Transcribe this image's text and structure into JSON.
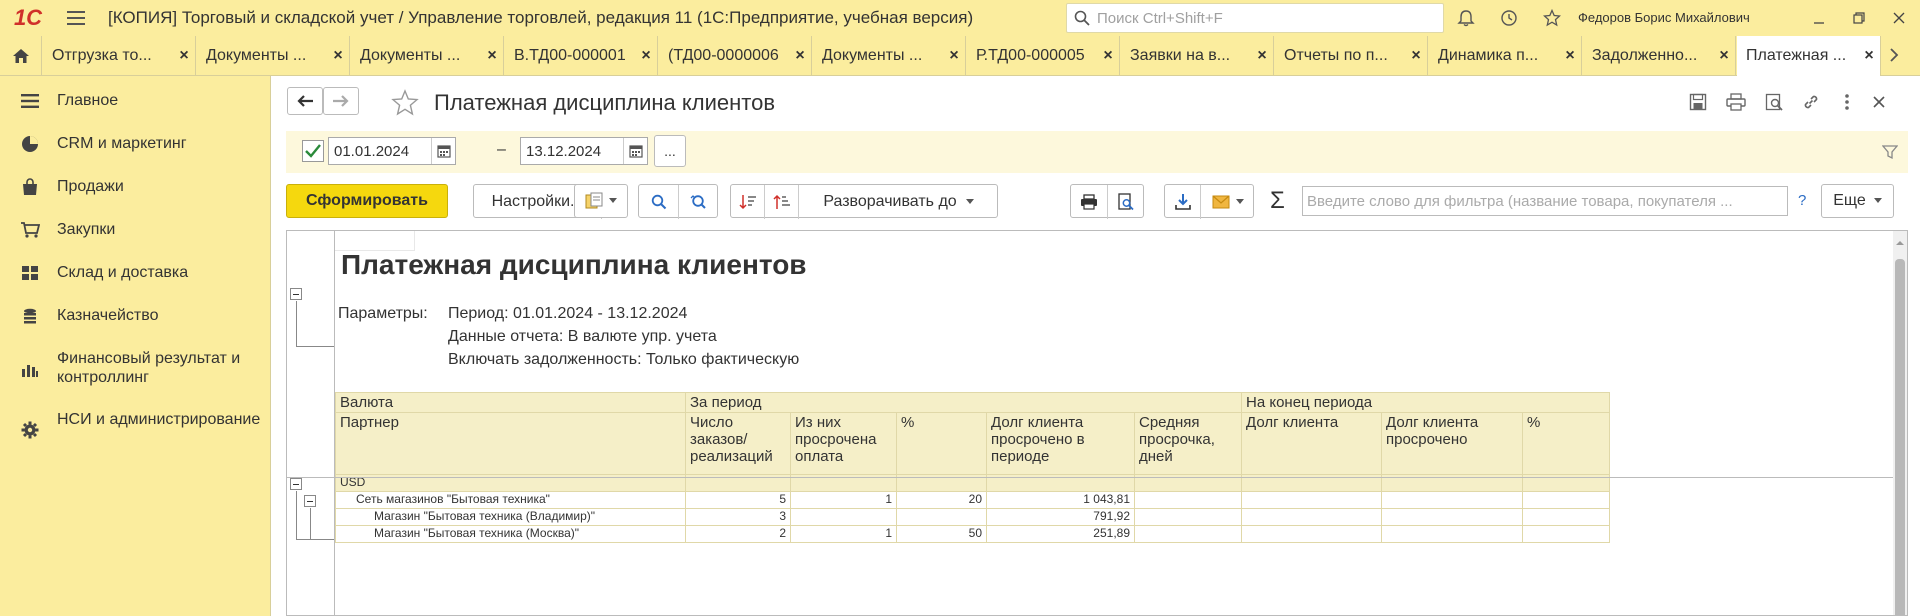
{
  "app": {
    "logo": "1C",
    "title": "[КОПИЯ] Торговый и складской учет / Управление торговлей, редакция 11  (1С:Предприятие, учебная версия)",
    "search_placeholder": "Поиск Ctrl+Shift+F",
    "user": "Федоров Борис Михайлович"
  },
  "tabs": [
    {
      "label": "Отгрузка то..."
    },
    {
      "label": "Документы ..."
    },
    {
      "label": "Документы ..."
    },
    {
      "label": "В.ТД00-000001"
    },
    {
      "label": "(ТД00-0000006"
    },
    {
      "label": "Документы ..."
    },
    {
      "label": "Р.ТД00-000005"
    },
    {
      "label": "Заявки на в..."
    },
    {
      "label": "Отчеты по п..."
    },
    {
      "label": "Динамика п..."
    },
    {
      "label": "Задолженно..."
    },
    {
      "label": "Платежная ..."
    }
  ],
  "sidebar": {
    "items": [
      {
        "label": "Главное",
        "icon": "menu-icon"
      },
      {
        "label": "CRM и маркетинг",
        "icon": "pie-chart-icon"
      },
      {
        "label": "Продажи",
        "icon": "shopping-bag-icon"
      },
      {
        "label": "Закупки",
        "icon": "cart-icon"
      },
      {
        "label": "Склад и доставка",
        "icon": "warehouse-icon"
      },
      {
        "label": "Казначейство",
        "icon": "coins-icon"
      },
      {
        "label": "Финансовый результат и контроллинг",
        "icon": "bar-chart-icon"
      },
      {
        "label": "НСИ и администрирование",
        "icon": "gear-icon"
      }
    ]
  },
  "page": {
    "title": "Платежная дисциплина клиентов"
  },
  "filter": {
    "enabled": true,
    "date_from": "01.01.2024",
    "dash": "–",
    "date_to": "13.12.2024",
    "dots_label": "..."
  },
  "toolbar": {
    "generate_label": "Сформировать",
    "settings_label": "Настройки...",
    "expand_label": "Разворачивать до",
    "sigma": "Σ",
    "filter_placeholder": "Введите слово для фильтра (название товара, покупателя ...",
    "help": "?",
    "more_label": "Еще"
  },
  "report": {
    "title": "Платежная дисциплина клиентов",
    "params_label": "Параметры:",
    "params": [
      "Период: 01.01.2024 - 13.12.2024",
      "Данные отчета: В валюте упр. учета",
      "Включать задолженность: Только фактическую"
    ],
    "headers": {
      "currency": "Валюта",
      "for_period": "За период",
      "end_period": "На конец периода",
      "partner": "Партнер",
      "orders_count": "Число заказов/реализаций",
      "overdue_paid": "Из них просрочена оплата",
      "percent": "%",
      "debt_overdue_period": "Долг клиента просрочено в периоде",
      "avg_delay": "Средняя просрочка, дней",
      "debt": "Долг клиента",
      "debt_overdue": "Долг клиента просрочено",
      "percent_end": "%"
    },
    "group": "USD",
    "rows": [
      {
        "partner": "Сеть магазинов \"Бытовая техника\"",
        "orders": "5",
        "overdue": "1",
        "percent": "20",
        "debt_overdue": "1 043,81",
        "level": 1
      },
      {
        "partner": "Магазин \"Бытовая техника (Владимир)\"",
        "orders": "3",
        "overdue": "",
        "percent": "",
        "debt_overdue": "791,92",
        "level": 2
      },
      {
        "partner": "Магазин \"Бытовая техника (Москва)\"",
        "orders": "2",
        "overdue": "1",
        "percent": "50",
        "debt_overdue": "251,89",
        "level": 2
      }
    ]
  }
}
